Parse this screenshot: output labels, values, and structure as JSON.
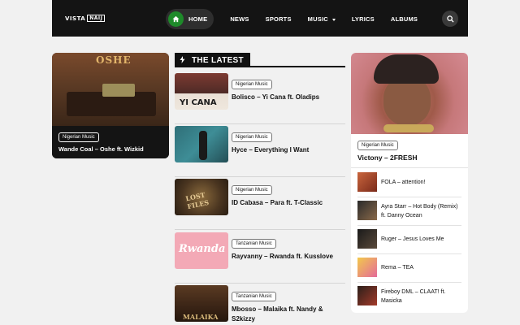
{
  "site": {
    "logo_left": "VISTA",
    "logo_box": "NAIJ"
  },
  "nav": {
    "items": [
      "HOME",
      "NEWS",
      "SPORTS",
      "MUSIC",
      "LYRICS",
      "ALBUMS"
    ],
    "active": "HOME"
  },
  "icons": {
    "home": "home-icon",
    "search": "search-icon",
    "bolt": "bolt-icon",
    "caret": "caret-down-icon"
  },
  "colors": {
    "header_bg": "#141414",
    "accent_green": "#1e8a2a",
    "page_bg": "#f1f1f1"
  },
  "featured": {
    "tag": "Nigerian Music",
    "title": "Wande Coal – Oshe ft. Wizkid",
    "image_text": "OSHE"
  },
  "latest": {
    "heading": "THE LATEST",
    "posts": [
      {
        "tag": "Nigerian Music",
        "title": "Bolisco – Yi Cana ft. Oladips",
        "image_text": "YI CANA"
      },
      {
        "tag": "Nigerian Music",
        "title": "Hyce – Everything I Want",
        "image_text": ""
      },
      {
        "tag": "Nigerian Music",
        "title": "ID Cabasa – Para ft. T-Classic",
        "image_text": "LOST FILES"
      },
      {
        "tag": "Tanzanian Music",
        "title": "Rayvanny – Rwanda ft. Kusslove",
        "image_text": "Rwanda"
      },
      {
        "tag": "Tanzanian Music",
        "title": "Mbosso – Malaika ft. Nandy & S2kizzy",
        "image_text": "MALAIKA"
      }
    ]
  },
  "sidebar": {
    "hero": {
      "tag": "Nigerian Music",
      "title": "Victony – 2FRESH"
    },
    "items": [
      {
        "title": "FOLA – attention!"
      },
      {
        "title": "Ayra Starr – Hot Body (Remix) ft. Danny Ocean"
      },
      {
        "title": "Ruger – Jesus Loves Me"
      },
      {
        "title": "Rema – TEA"
      },
      {
        "title": "Fireboy DML – CLAAT! ft. Masicka"
      }
    ]
  }
}
